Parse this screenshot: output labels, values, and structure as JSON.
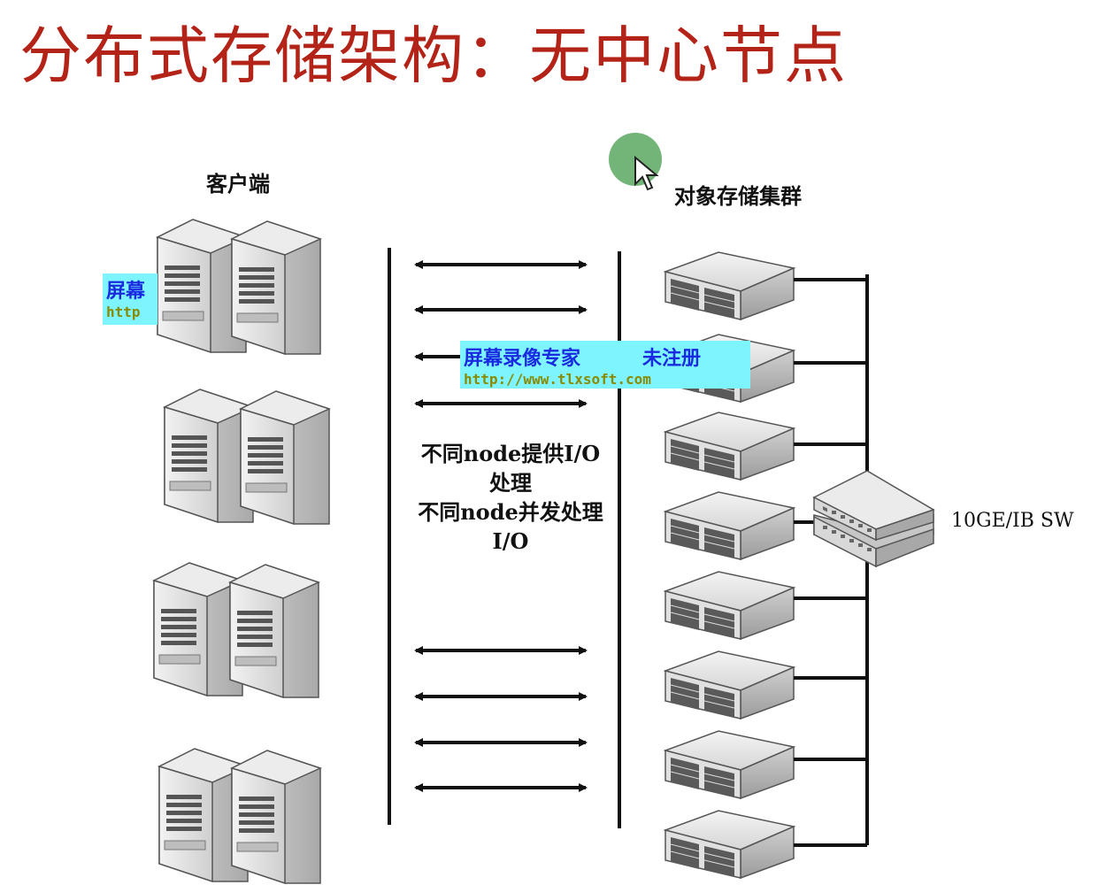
{
  "title": "分布式存储架构：无中心节点",
  "labels": {
    "client": "客户端",
    "cluster": "对象存储集群",
    "switch": "10GE/IB SW"
  },
  "note": {
    "line1": "不同node提供I/O",
    "line2": "处理",
    "line3": "不同node并发处理",
    "line4": "I/O"
  },
  "watermark": {
    "name": "屏幕录像专家",
    "status": "未注册",
    "url": "http://www.tlxsoft.com",
    "partial_name": "屏幕",
    "partial_url": "http"
  },
  "icons": {
    "client_server": "tower-server-pair-icon",
    "storage_node": "rack-server-icon",
    "network_switch": "network-switch-icon",
    "cursor": "mouse-cursor-icon",
    "arrow": "double-arrow-icon"
  },
  "colors": {
    "title": "#b32317",
    "watermark_bg": "#7df4ff",
    "watermark_text": "#1a2ae0",
    "cursor_highlight": "#5aa862"
  }
}
